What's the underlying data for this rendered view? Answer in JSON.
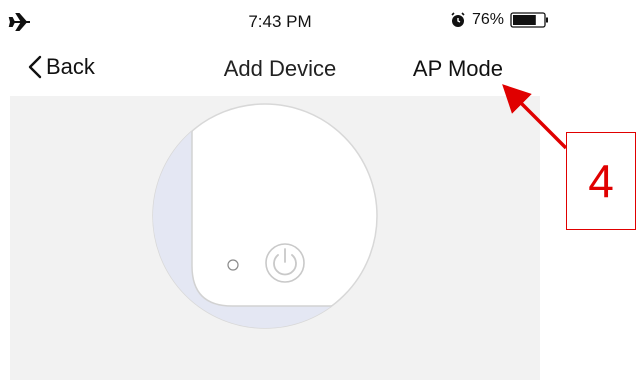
{
  "status_bar": {
    "time": "7:43 PM",
    "battery_percent": "76%",
    "battery_level": 0.76,
    "icons": [
      "airplane-icon",
      "alarm-icon",
      "battery-icon"
    ]
  },
  "nav": {
    "back_label": "Back",
    "title": "Add Device",
    "ap_mode_label": "AP Mode"
  },
  "annotation": {
    "label": "4",
    "color": "#e00000"
  },
  "colors": {
    "panel_background": "#f2f2f2",
    "device_tint": "#e4e7f3"
  }
}
